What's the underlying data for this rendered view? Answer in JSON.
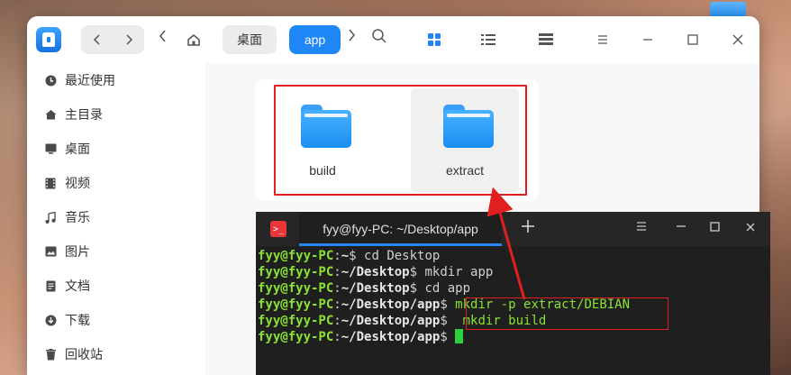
{
  "file_manager": {
    "nav": {
      "back_icon": "chevron-left-icon",
      "forward_icon": "chevron-right-icon"
    },
    "breadcrumb": [
      {
        "label": "桌面"
      },
      {
        "label": "app",
        "active": true
      }
    ],
    "sidebar": [
      {
        "icon": "clock-icon",
        "label": "最近使用"
      },
      {
        "icon": "home-icon",
        "label": "主目录"
      },
      {
        "icon": "desktop-icon",
        "label": "桌面"
      },
      {
        "icon": "video-icon",
        "label": "视频"
      },
      {
        "icon": "music-icon",
        "label": "音乐"
      },
      {
        "icon": "picture-icon",
        "label": "图片"
      },
      {
        "icon": "document-icon",
        "label": "文档"
      },
      {
        "icon": "download-icon",
        "label": "下载"
      },
      {
        "icon": "trash-icon",
        "label": "回收站"
      }
    ],
    "files": [
      {
        "name": "build",
        "type": "folder"
      },
      {
        "name": "extract",
        "type": "folder"
      }
    ]
  },
  "terminal": {
    "tab_title": "fyy@fyy-PC: ~/Desktop/app",
    "lines": [
      {
        "user": "fyy@fyy-PC",
        "path": "~",
        "cmd": " cd Desktop"
      },
      {
        "user": "fyy@fyy-PC",
        "path": "~/Desktop",
        "cmd": " mkdir app"
      },
      {
        "user": "fyy@fyy-PC",
        "path": "~/Desktop",
        "cmd": " cd app"
      },
      {
        "user": "fyy@fyy-PC",
        "path": "~/Desktop/app",
        "cmd": " mkdir -p extract/DEBIAN"
      },
      {
        "user": "fyy@fyy-PC",
        "path": "~/Desktop/app",
        "cmd": "  mkdir build"
      },
      {
        "user": "fyy@fyy-PC",
        "path": "~/Desktop/app",
        "cmd": " "
      }
    ]
  },
  "colors": {
    "accent": "#1f86f5",
    "annotation": "#e02020",
    "prompt_green": "#8ae234"
  }
}
